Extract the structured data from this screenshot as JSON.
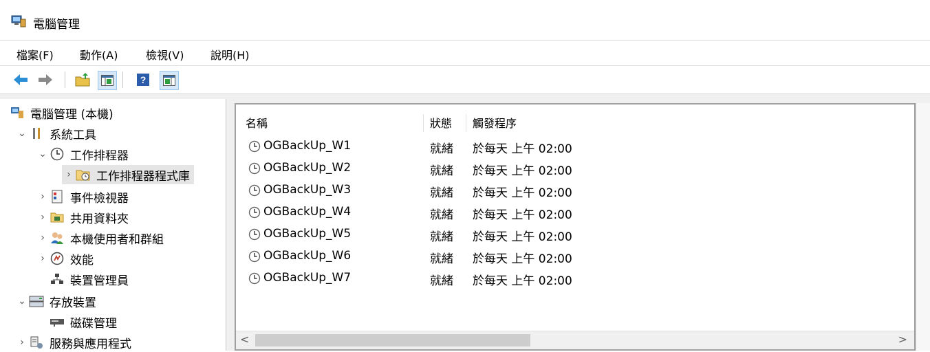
{
  "window": {
    "title": "電腦管理"
  },
  "menu": [
    "檔案(F)",
    "動作(A)",
    "檢視(V)",
    "說明(H)"
  ],
  "toolbar": {
    "icons": [
      "back-arrow-icon",
      "forward-arrow-icon",
      "up-folder-icon",
      "show-hide-console-tree-icon",
      "help-icon",
      "show-hide-action-pane-icon"
    ]
  },
  "tree": {
    "root": "電腦管理 (本機)",
    "system_tools": "系統工具",
    "task_scheduler": "工作排程器",
    "task_library": "工作排程器程式庫",
    "event_viewer": "事件檢視器",
    "shared_folders": "共用資料夾",
    "local_users": "本機使用者和群組",
    "performance": "效能",
    "device_manager": "裝置管理員",
    "storage": "存放裝置",
    "disk_mgmt": "磁碟管理",
    "services_apps": "服務與應用程式"
  },
  "list": {
    "headers": {
      "name": "名稱",
      "status": "狀態",
      "trigger": "觸發程序"
    },
    "rows": [
      {
        "name": "OGBackUp_W1",
        "status": "就緒",
        "trigger": "於每天 上午 02:00"
      },
      {
        "name": "OGBackUp_W2",
        "status": "就緒",
        "trigger": "於每天 上午 02:00"
      },
      {
        "name": "OGBackUp_W3",
        "status": "就緒",
        "trigger": "於每天 上午 02:00"
      },
      {
        "name": "OGBackUp_W4",
        "status": "就緒",
        "trigger": "於每天 上午 02:00"
      },
      {
        "name": "OGBackUp_W5",
        "status": "就緒",
        "trigger": "於每天 上午 02:00"
      },
      {
        "name": "OGBackUp_W6",
        "status": "就緒",
        "trigger": "於每天 上午 02:00"
      },
      {
        "name": "OGBackUp_W7",
        "status": "就緒",
        "trigger": "於每天 上午 02:00"
      }
    ]
  },
  "scroll": {
    "left": "<",
    "right": ">"
  }
}
